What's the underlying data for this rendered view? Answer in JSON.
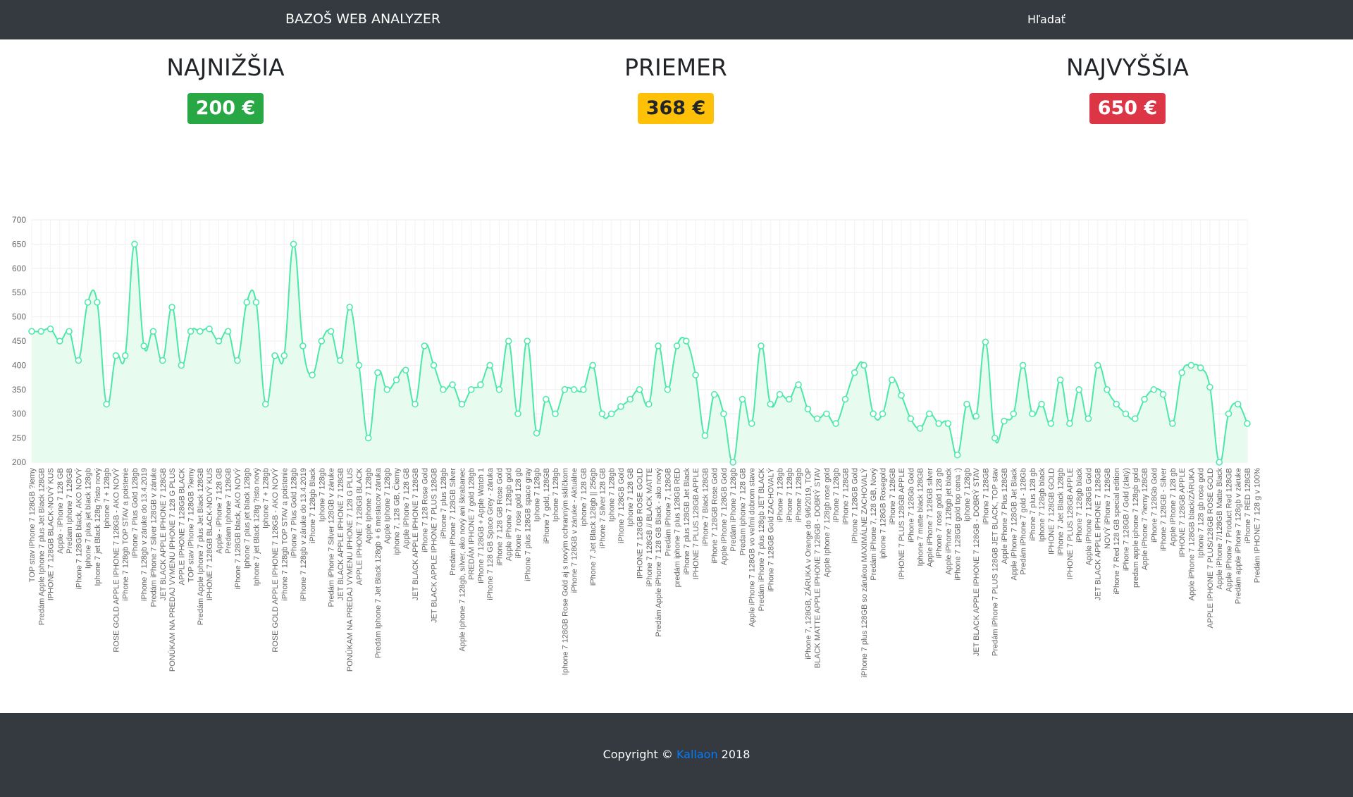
{
  "navbar": {
    "brand": "BAZOŠ WEB ANALYZER",
    "search_label": "Hľadať"
  },
  "stats": {
    "lowest": {
      "title": "NAJNIŽŠIA",
      "value": "200 €"
    },
    "average": {
      "title": "PRIEMER",
      "value": "368 €"
    },
    "highest": {
      "title": "NAJVYŠŠIA",
      "value": "650 €"
    }
  },
  "footer": {
    "prefix": "Copyright © ",
    "author": "Kallaon",
    "year": " 2018"
  },
  "chart_data": {
    "type": "area",
    "ylim": [
      200,
      700
    ],
    "yticks": [
      200,
      250,
      300,
      350,
      400,
      450,
      500,
      550,
      600,
      650,
      700
    ],
    "grid": true,
    "line_color": "#4be8a8",
    "fill_color": "#e8fbef",
    "categories": [
      "TOP stav iPhone 7 128GB ?ierny",
      "Predám Apple Iphone 7 plus Jet Black 128GB",
      "IPHONE 7 128GB BLACK-NOVÝ KUS",
      "Apple - iPhone 7 128 GB",
      "Predam Iphone 7 128GB",
      "iPhone 7 128GB black, AKO NOVÝ",
      "Iphone 7 plus jet black 128gb",
      "Iphone 7 jet Black 128g ?isto nový",
      "Iphone 7 + 128gb",
      "ROSE GOLD APPLE IPHONE 7 128GB - AKO NOVÝ",
      "iPhone 7 128gb TOP STAV a poistenie",
      "iPhone 7 Plus Gold 128gb",
      "iPhone 7 128gb v záruke do 13.4.2019",
      "Predám iPhone 7 Silver 128GB v záruke",
      "JET BLACK APPLE IPHONE 7 128GB",
      "PONÚKAM NA PREDAJ VYMENU IPHONE 7 128 G PLUS",
      "APPLE IPHONE 7 128GB BLACK",
      "TOP stav iPhone 7 128GB ?ierny",
      "Predám Apple Iphone 7 plus Jet Black 128GB",
      "IPHONE 7 128GB BLACK-NOVÝ KUS",
      "Apple - iPhone 7 128 GB",
      "Predam Iphone 7 128GB",
      "iPhone 7 128GB black, AKO NOVÝ",
      "Iphone 7 plus jet black 128gb",
      "Iphone 7 jet Black 128g ?isto nový",
      "Iphone 7 + 128gb",
      "ROSE GOLD APPLE IPHONE 7 128GB - AKO NOVÝ",
      "iPhone 7 128gb TOP STAV a poistenie",
      "iPhone 7 Plus Gold 128gb",
      "iPhone 7 128gb v záruke do 13.4.2019",
      "iPhone 7 128gb Black",
      "Iphone 7 128gb",
      "Predám iPhone 7 Silver 128GB v záruke",
      "JET BLACK APPLE IPHONE 7 128GB",
      "PONÚKAM NA PREDAJ VYMENU IPHONE 7 128 G PLUS",
      "APPLE IPHONE 7 128GB BLACK",
      "Apple Iphone 7 128gb",
      "Predám Iphone 7 Jet Black 128gb + 6 mesiacov záruka",
      "Apple Iphone 7 128gb",
      "iphone 7, 128 GB, Čierny",
      "Apple iPhone 7 128 GB",
      "JET BLACK APPLE IPHONE 7 128GB",
      "iPhone 7 128 Rose Gold",
      "JET BLACK APPLE IPHONE 7 PLUS 128GB",
      "iPhone 7 plus 128gb",
      "Predám iPhone 7 128GB Silver",
      "Apple Iphone 7 128gb, silver, ako nový ani škrabanec",
      "PREDÁM IPHONE 7 gold 128gb",
      "iPhone 7 128GB + Apple Watch 1",
      "iPhone 7 128 GB Space Grey - záruka",
      "iPhone 7 128 GB Rose Gold",
      "Apple iPhone 7 128gb gold",
      "iPhone 7 rose gold 128 gb",
      "iPhone 7 plus 128GB space gray",
      "Iphone 7 128gb",
      "iPhone 7 gold, 128GB",
      "Iphone 7 128gb",
      "Iphone 7 128GB Rose Gold aj s novým ochranným sklíčkom",
      "iPhone 7 128GB v záruke - Aktuálne",
      "iphone 7 128 GB",
      "iPhone 7 Jet Black 128gb || 256gb",
      "iPhone 7 Silver 128 GB",
      "Iphone 7 128gb",
      "iPhone 7 128GB Gold",
      "Iphone 7 128 GB",
      "IPHONE 7 128GB ROSE GOLD",
      "iPhone 7 128GB // BLACK MATTE",
      "Predám Apple iPhone 7 128 GB Black - ako nový",
      "Predám iPhone 7, 128GB",
      "predám iphone 7 plus 128GB RED",
      "iPhone 7 plus 128GB Jet Black",
      "IPHONE 7 PLUS 128GB APPLE",
      "iPhone 7 Black 128GB",
      "iPhone 7 128GB Rose Gold",
      "Apple iPhone 7 128GB Gold",
      "Predám iPhone 7 128gb",
      "Predam iphone 7 128 GB",
      "Apple iPhone 7 128GB vo veľmi dobrom stave",
      "Predám iPhone 7 plus 128gb JET BLACK",
      "iPhone 7 128GB Gold ZACHOVALÝ",
      "iPhone 7 128gb",
      "iPhone 7 128gb",
      "iPhone 7 128gb",
      "iPhone 7, 128GB, ZÁRUKA v Orange do 9/6/2019, TOP",
      "BLACK MATTE APPLE IPHONE 7 128GB - DOBRÝ STAV",
      "Apple iphone 7 128gb rose gold",
      "iPhone 7 128gb",
      "iPhone 7 128GB",
      "iPhone 7 128GB Gold",
      "iPhone 7 plus 128GB so zárukou MAXIMÁLNE ZACHOVALÝ",
      "Predám iPhone 7, 128 GB, Nový",
      "iphone 7 128GB Rosegold",
      "iPhone 7 128GB",
      "IPHONE 7 PLUS 128GB APPLE",
      "iPhone 7 128Gb Gold",
      "Iphone 7 matte black 128GB",
      "Apple iPhone 7 128GB silver",
      "iPhone 7 rose gold 128 gb",
      "Apple iPhone 7 128gb jet black",
      "iPhone 7 128GB gold top cena :)",
      "iphone 7 128gb",
      "JET BLACK APPLE IPHONE 7 128GB - DOBRÝ STAV",
      "iPhone 7 128GB",
      "Predám iPhone 7 PLUS 128GB JET BLACK, TOP stav",
      "Apple iPhone 7 Plus 128GB",
      "Apple iPhone 7 128GB Jet Black",
      "Predám iPhone 7 gold - 128Gb",
      "iPhone 7 plus 128 gb",
      "Iphone 7 128gb black",
      "IPHONE 7 128GB GOLD",
      "iPhone 7 Jet Black 128gb",
      "IPHONE 7 PLUS 128GB APPLE",
      "iPhone 7 128gb black",
      "Apple iPhone 7 128GB Gold",
      "JET BLACK APPLE IPHONE 7 128GB",
      "NOVÝ iPhone 7 128GB",
      "iPhone 7 Red 128 GB special edition",
      "iPhone 7 128GB / Gold (zlatý)",
      "predam apple iphone 7 128gb gold",
      "Apple iPhone 7 ?ierny 128GB",
      "iPhone 7 128Gb Gold",
      "iPhone 7 128GB - Silver",
      "Apple iPhone 7 128 gb",
      "IPHONE 7 128GB APPLE",
      "Apple iPhone 7 128GB black/ZÁRUKA",
      "Iphone 7 128 gb rose gold",
      "APPLE IPHONE 7 PLUS/128GB ROSE GOLD",
      "Apple iPhone 7/128GB Matte Black",
      "Apple iPhone 7 Product Red 128GB",
      "Predám apple iPhone 7 128gb v záruke",
      "iPhone 7 RED 128GB",
      "Predám IPHONE 7 128 g v 100%"
    ],
    "values": [
      470,
      470,
      475,
      450,
      470,
      410,
      530,
      530,
      320,
      420,
      420,
      650,
      440,
      470,
      410,
      520,
      400,
      470,
      470,
      475,
      450,
      470,
      410,
      530,
      530,
      320,
      420,
      420,
      650,
      440,
      380,
      450,
      470,
      410,
      520,
      400,
      250,
      385,
      350,
      370,
      390,
      320,
      440,
      400,
      350,
      360,
      320,
      350,
      360,
      400,
      350,
      450,
      300,
      450,
      260,
      330,
      300,
      350,
      350,
      350,
      400,
      300,
      300,
      315,
      330,
      350,
      320,
      440,
      350,
      440,
      450,
      380,
      255,
      340,
      300,
      200,
      330,
      280,
      440,
      320,
      340,
      330,
      360,
      310,
      290,
      300,
      280,
      330,
      385,
      400,
      300,
      300,
      370,
      338,
      290,
      270,
      300,
      280,
      280,
      215,
      320,
      295,
      448,
      250,
      285,
      300,
      400,
      300,
      320,
      280,
      370,
      280,
      350,
      290,
      400,
      350,
      320,
      300,
      290,
      330,
      350,
      340,
      280,
      385,
      400,
      395,
      355,
      200,
      300,
      320,
      280
    ]
  }
}
